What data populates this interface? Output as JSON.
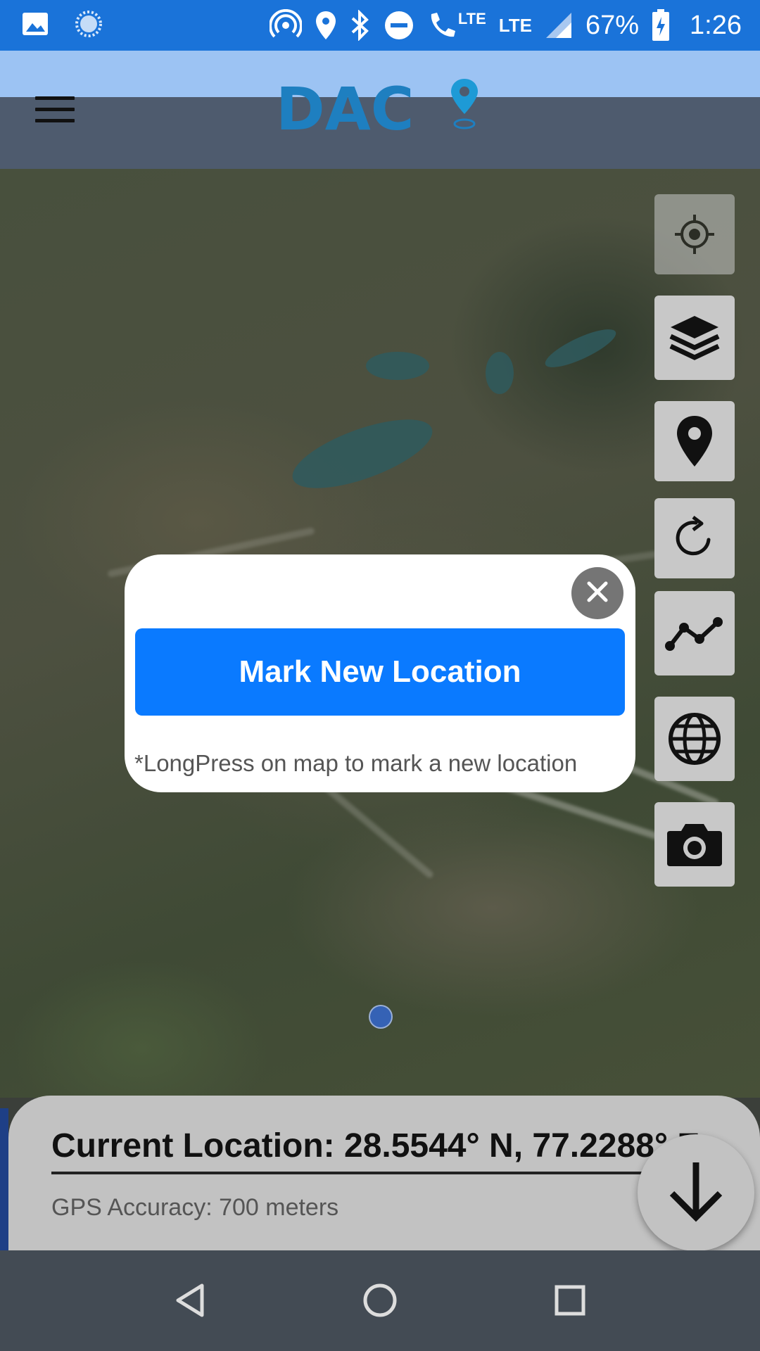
{
  "status_bar": {
    "battery": "67%",
    "time": "1:26",
    "network_1": "LTE",
    "network_2": "LTE",
    "icons": [
      "image-icon",
      "sync-icon",
      "hotspot-icon",
      "location-icon",
      "bluetooth-icon",
      "dnd-icon",
      "volte-call-icon",
      "signal-icon",
      "battery-charging-icon"
    ]
  },
  "header": {
    "logo_text": "DAC",
    "brand_color": "#1e7fc0",
    "menu_icon": "hamburger-menu-icon"
  },
  "side_toolbar": [
    {
      "name": "my-location",
      "icon": "crosshair-icon"
    },
    {
      "name": "layers",
      "icon": "layers-icon"
    },
    {
      "name": "marker",
      "icon": "map-pin-icon"
    },
    {
      "name": "refresh",
      "icon": "refresh-icon"
    },
    {
      "name": "track",
      "icon": "line-chart-icon"
    },
    {
      "name": "globe",
      "icon": "globe-icon"
    },
    {
      "name": "camera",
      "icon": "camera-icon"
    }
  ],
  "popup": {
    "mark_button_label": "Mark New Location",
    "hint": "*LongPress on map to mark a new location",
    "button_color": "#0a7aff"
  },
  "bottom_panel": {
    "current_location": "Current Location: 28.5544° N, 77.2288° E",
    "gps_accuracy": "GPS Accuracy: 700 meters"
  },
  "nav_bar": {
    "buttons": [
      "back",
      "home",
      "recents"
    ]
  }
}
